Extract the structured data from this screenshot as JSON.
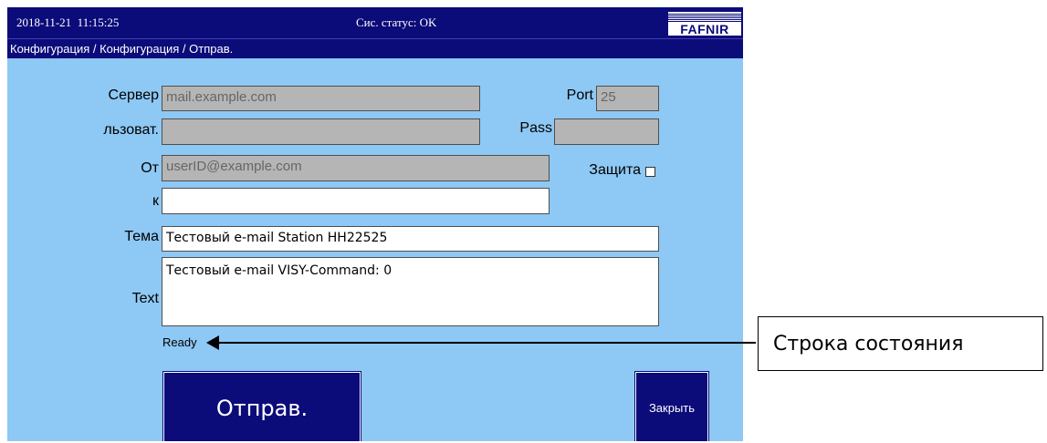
{
  "header": {
    "datetime": "2018-11-21  11:15:25",
    "system_status": "Сис. статус: OK",
    "logo_text": "FAFNIR"
  },
  "breadcrumb": "Конфигурация / Конфигурация / Отправ.",
  "form": {
    "server_label": "Сервер",
    "server_value": "mail.example.com",
    "port_label": "Port",
    "port_value": "25",
    "user_label": "льзоват.",
    "user_value": "",
    "pass_label": "Pass",
    "pass_value": "",
    "from_label": "От",
    "from_value": "userID@example.com",
    "security_label": "Защита",
    "security_checked": false,
    "to_label": "к",
    "to_value": "",
    "subject_label": "Тема",
    "subject_value": "Тестовый e-mail Station HH22525",
    "text_label": "Text",
    "text_value": "Тестовый e-mail VISY-Command: 0"
  },
  "status_text": "Ready",
  "buttons": {
    "send": "Отправ.",
    "close": "Закрыть"
  },
  "annotation": {
    "callout_label": "Строка состояния"
  },
  "colors": {
    "panel_background": "#8ec8f4",
    "header_background": "#0b0b7a",
    "disabled_field": "#b5b5b5"
  }
}
